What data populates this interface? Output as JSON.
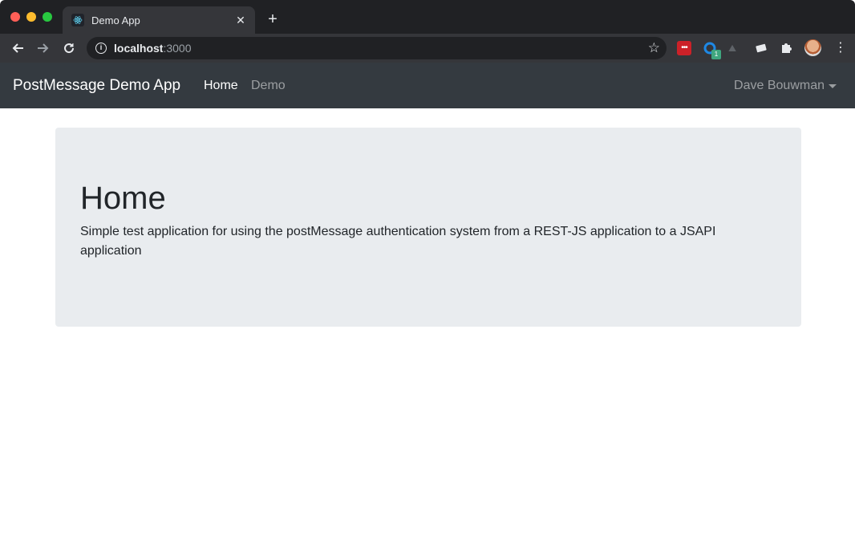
{
  "browser": {
    "tab_title": "Demo App",
    "tab_close_icon": "close-icon",
    "new_tab_icon": "plus-icon",
    "url_host": "localhost",
    "url_port": ":3000",
    "extension_badge": "1"
  },
  "navbar": {
    "brand": "PostMessage Demo App",
    "links": [
      {
        "label": "Home",
        "active": true
      },
      {
        "label": "Demo",
        "active": false
      }
    ],
    "user": "Dave Bouwman"
  },
  "main": {
    "title": "Home",
    "description": "Simple test application for using the postMessage authentication system from a REST-JS application to a JSAPI application"
  },
  "colors": {
    "navbar_bg": "#343a40",
    "jumbotron_bg": "#e9ecef",
    "chrome_bg": "#202124"
  }
}
